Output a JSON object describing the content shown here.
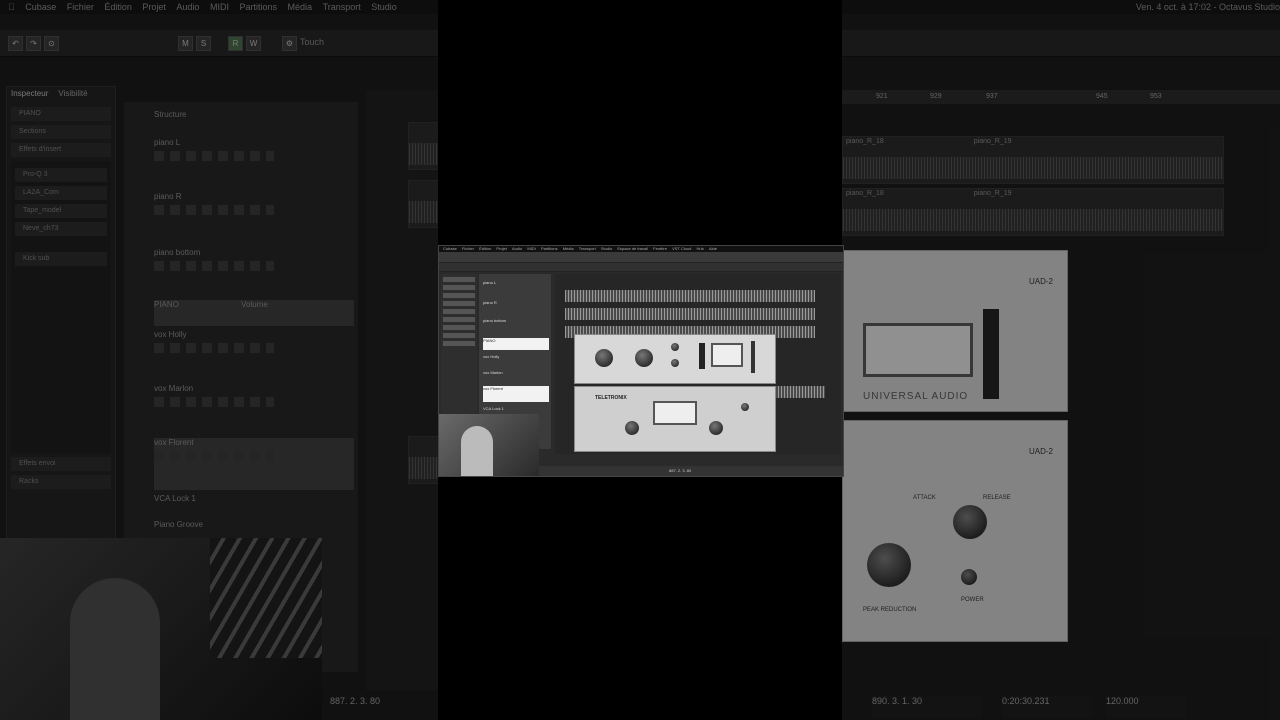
{
  "background": {
    "menu_items": [
      "Cubase",
      "Fichier",
      "Édition",
      "Projet",
      "Audio",
      "MIDI",
      "Partitions",
      "Média",
      "Transport",
      "Studio"
    ],
    "right_title": "Ven. 4 oct. à 17:02 - Octavus Studio",
    "inspector_tabs": [
      "Inspecteur",
      "Visibilité"
    ],
    "inspector_track": "PIANO",
    "inspector_sections": [
      "Sections",
      "Effets d'insert",
      "Effets envoi",
      "Racks"
    ],
    "insert_slots": [
      "Pro-Q 3",
      "LA2A_Com",
      "Tape_model",
      "Neve_ch73",
      "Kick sub"
    ],
    "tracks": [
      {
        "name": "Structure",
        "selected": false
      },
      {
        "name": "piano L",
        "selected": false
      },
      {
        "name": "piano R",
        "selected": false
      },
      {
        "name": "piano bottom",
        "selected": false
      },
      {
        "name": "PIANO",
        "selected": true
      },
      {
        "name": "vox Holly",
        "selected": false
      },
      {
        "name": "vox Marlon",
        "selected": false
      },
      {
        "name": "vox Florent",
        "selected": true
      },
      {
        "name": "VCA Lock 1",
        "selected": false
      },
      {
        "name": "Piano Groove",
        "selected": false
      }
    ],
    "track_volume_label": "Volume",
    "ruler_numbers_left": [],
    "ruler_numbers_right": [
      "921",
      "929",
      "937",
      "945",
      "953"
    ],
    "clip_labels_right": [
      "piano_R_18",
      "piano_R_19",
      "piano_R_18",
      "piano_R_19"
    ],
    "plugin_names_right": [
      "UAD-2",
      "UAD-2"
    ],
    "plugin_brand_right": "UNIVERSAL AUDIO",
    "plugin2_labels": [
      "ATTACK",
      "RELEASE",
      "PEAK REDUCTION",
      "POWER"
    ],
    "time_left": "887. 2. 3. 80",
    "time_right": "890. 3. 1. 30",
    "tempo": "120.000",
    "time_clock": "0:20:30.231"
  },
  "center": {
    "menu_items": [
      "Cubase",
      "Fichier",
      "Édition",
      "Projet",
      "Audio",
      "MIDI",
      "Partitions",
      "Média",
      "Transport",
      "Studio",
      "Espace de travail",
      "Fenêtre",
      "VST Cloud",
      "Hub",
      "Aide"
    ],
    "tracks": [
      {
        "name": "piano L",
        "selected": false
      },
      {
        "name": "piano R",
        "selected": false
      },
      {
        "name": "piano bottom",
        "selected": false
      },
      {
        "name": "PIANO",
        "selected": true
      },
      {
        "name": "vox Holly",
        "selected": false
      },
      {
        "name": "vox Marlon",
        "selected": false
      },
      {
        "name": "vox Florent",
        "selected": true
      },
      {
        "name": "VCA Lock 1",
        "selected": false
      }
    ],
    "plugin1_brand": "TELETRONIX",
    "plugin2_brand": "TELETRONIX",
    "status_time": "887. 2. 3. 80"
  }
}
